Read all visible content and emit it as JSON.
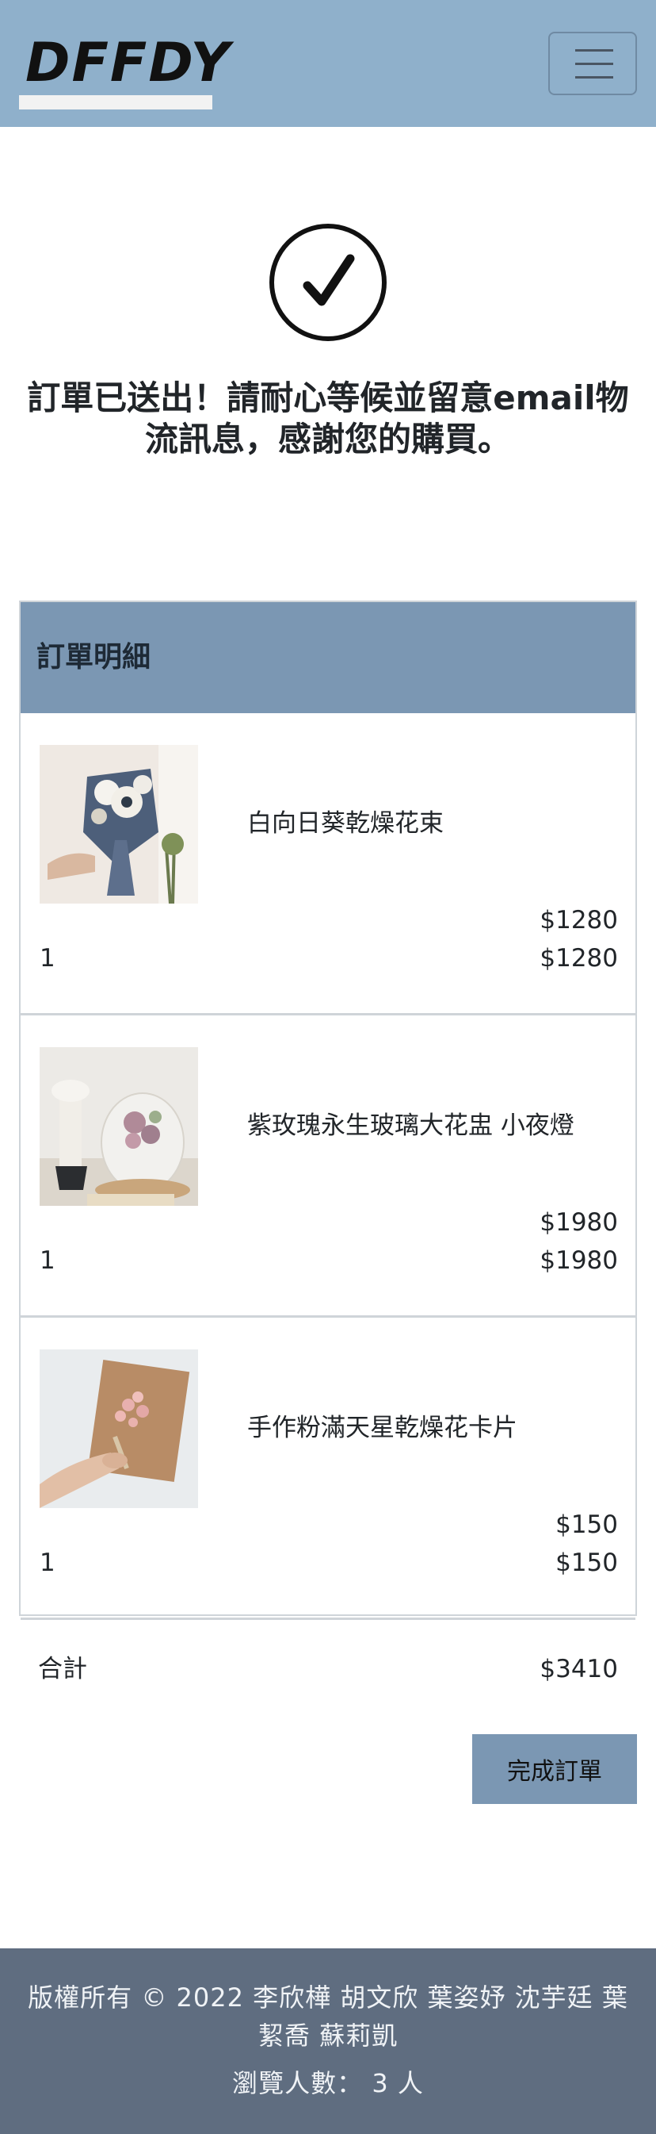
{
  "header": {
    "brand": "DFFDY",
    "menu_icon": "hamburger-menu-icon"
  },
  "success": {
    "icon": "check-circle-icon",
    "message": "訂單已送出！請耐心等候並留意email物流訊息，感謝您的購買。"
  },
  "order": {
    "title": "訂單明細",
    "items": [
      {
        "image": "dried-sunflower-bouquet-photo",
        "name": "白向日葵乾燥花束",
        "price": "$1280",
        "quantity": "1",
        "subtotal": "$1280"
      },
      {
        "image": "preserved-rose-glass-dome-lamp-photo",
        "name": "紫玫瑰永生玻璃大花盅 小夜燈",
        "price": "$1980",
        "quantity": "1",
        "subtotal": "$1980"
      },
      {
        "image": "pink-gypsophila-card-photo",
        "name": "手作粉滿天星乾燥花卡片",
        "price": "$150",
        "quantity": "1",
        "subtotal": "$150"
      }
    ],
    "total_label": "合計",
    "total_value": "$3410",
    "complete_button": "完成訂單"
  },
  "footer": {
    "copyright": "版權所有 © 2022 李欣樺 胡文欣 葉姿妤 沈芋廷 葉絜喬 蘇莉凱",
    "visitors": "瀏覽人數： 3 人"
  },
  "colors": {
    "navbar": "#8FB0CB",
    "card_header": "#7B97B3",
    "button": "#7B97B3",
    "footer": "#5F6D80"
  }
}
